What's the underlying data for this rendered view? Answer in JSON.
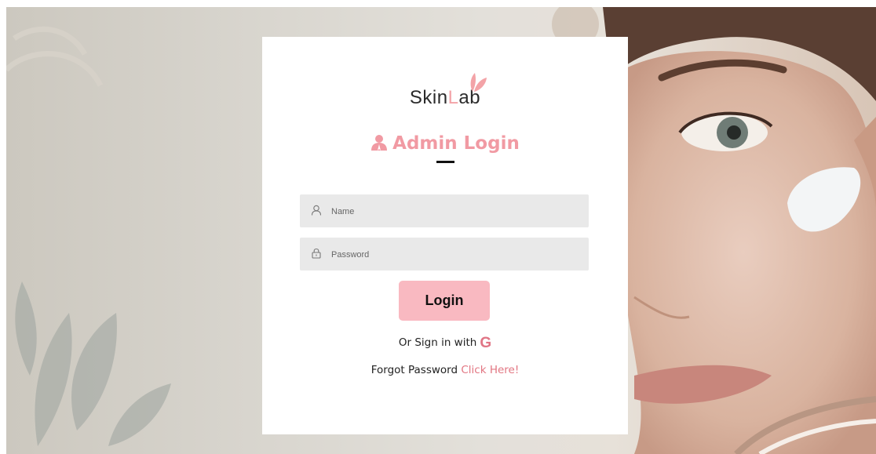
{
  "brand": {
    "logo_prefix": "Skin",
    "logo_l": "L",
    "logo_suffix": "ab"
  },
  "login": {
    "title": "Admin Login",
    "name_placeholder": "Name",
    "password_placeholder": "Password",
    "login_button": "Login",
    "or_sign_in": "Or Sign in with",
    "google_glyph": "G",
    "forgot_text": "Forgot Password",
    "forgot_link": "Click Here!"
  },
  "icons": {
    "title": "admin-user-icon",
    "name_field": "user-icon",
    "password_field": "lock-icon",
    "social": "google-icon",
    "logo": "leaf-icon"
  },
  "colors": {
    "accent_pink": "#f19aa3",
    "button_pink": "#f9b9c1",
    "link_pink": "#e27682",
    "field_bg": "#e9e9e9"
  }
}
